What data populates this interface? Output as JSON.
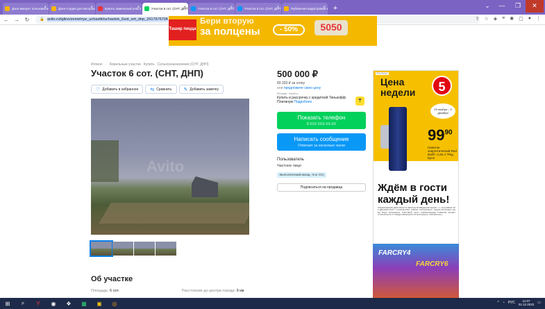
{
  "browser": {
    "tabs": [
      {
        "label": "Дзен-аккаунт пользователя",
        "color": "#f7b500"
      },
      {
        "label": "Дзен-студия для авторов",
        "color": "#f7b500"
      },
      {
        "label": "Купить земельный участок СНТ",
        "color": "#e8333a"
      },
      {
        "label": "Участок 6 сот. (СНТ, ДНП) ...",
        "color": "#02d15c",
        "active": true
      },
      {
        "label": "Участок 6 сот. (СНТ, ДНП) на",
        "color": "#0a98f7"
      },
      {
        "label": "Участок 6 сот. (СНТ, ДНП) на",
        "color": "#0a98f7"
      },
      {
        "label": "Публичная кадастровая карта",
        "color": "#f7b500"
      }
    ],
    "new_tab": "+",
    "window_controls": {
      "chevron": "⌄",
      "minimize": "—",
      "maximize": "❐",
      "close": "✕"
    },
    "url": "avito.ru/iglino/zemelnye_uchastki/uchastok_6sot_snt_dnp_2617676704",
    "toolbar_icons": [
      "share-icon",
      "bookmark-star-icon",
      "extension-icon",
      "menu-icon",
      "puzzle-icon",
      "panel-icon",
      "profile-icon",
      "more-icon"
    ]
  },
  "banner": {
    "brand": "Ташир пицца",
    "headline_top": "Бери вторую",
    "headline": "за полцены",
    "discount": "- 50%",
    "promo_code": "5050"
  },
  "listing": {
    "breadcrumbs": [
      "Иглино",
      "·",
      "Земельные участки",
      "Купить",
      "Сельхозназначения (СНТ, ДНП)"
    ],
    "title": "Участок 6 сот. (СНТ, ДНП)",
    "actions": {
      "favorite": "Добавить в избранное",
      "compare": "Сравнить",
      "note": "Добавить заметку"
    },
    "watermark": "Avito",
    "about_heading": "Об участке",
    "area_label": "Площадь:",
    "area_value": "6 сот.",
    "distance_label": "Расстояние до центра города:",
    "distance_value": "9 км"
  },
  "sidebar": {
    "price": "500 000 ₽",
    "per_sotka": "83 333 ₽ за сотку",
    "offer_prefix": "или",
    "offer_link": "предложите свою цену",
    "credit_label": "Реклама · tinkoff.ru",
    "credit_text": "Купить в рассрочку с кредиткой Тинькофф Платинум",
    "credit_more": "Подробнее",
    "show_phone": "Показать телефон",
    "phone_mask": "8 XXX XXX-XX-XX",
    "write_message": "Написать сообщение",
    "reply_time": "Отвечает за несколько часов",
    "seller_name": "Пользователь",
    "seller_type": "Частное лицо",
    "eco_badge": "Экологический вклад –5 кг CO₂",
    "subscribe": "Подписаться на продавца"
  },
  "ad_right": {
    "label": "РЕКЛАМА",
    "headline": "Цена недели",
    "store_number": "5",
    "dates": "29 ноября – 5 декабря",
    "price_main": "99",
    "price_cents": "90",
    "product": "Напиток энергетический Red Bull®, 0,25 л *Ред Булл",
    "slogan": "Ждём в гости каждый день!",
    "fine_print": "ПРЕДЛОЖЕНИЕ ДЕЙСТВУЕТ В ПЕРИОД ПРОВЕДЕНИЯ АКЦИИ – С 29 НОЯБРЯ ПО 5 ДЕКАБРЯ 2022 Г. КОЛИЧЕСТВО ТОВАРА ОГРАНИЧЕНО. АКЦИЯ ПРОХОДИТ НЕ ВО ВСЕХ МАГАЗИНАХ ТОРГОВОЙ СЕТИ. ИЗОБРАЖЕНИЕ ТОВАРОВ МОЖЕТ ОТЛИЧАТЬСЯ ОТ ПРЕДСТАВЛЕННОГО В МАГАЗИНАХ «ПЯТЁРОЧКА»."
  },
  "ad_game": {
    "title_left": "FARCRY4",
    "title_right": "FARCRY6"
  },
  "taskbar": {
    "language": "РУС",
    "time": "11:07",
    "date": "02.12.2022"
  },
  "colors": {
    "green": "#02d15c",
    "blue": "#0a98f7",
    "tabbar": "#7a63c2",
    "taskbar": "#1e2a4a"
  }
}
